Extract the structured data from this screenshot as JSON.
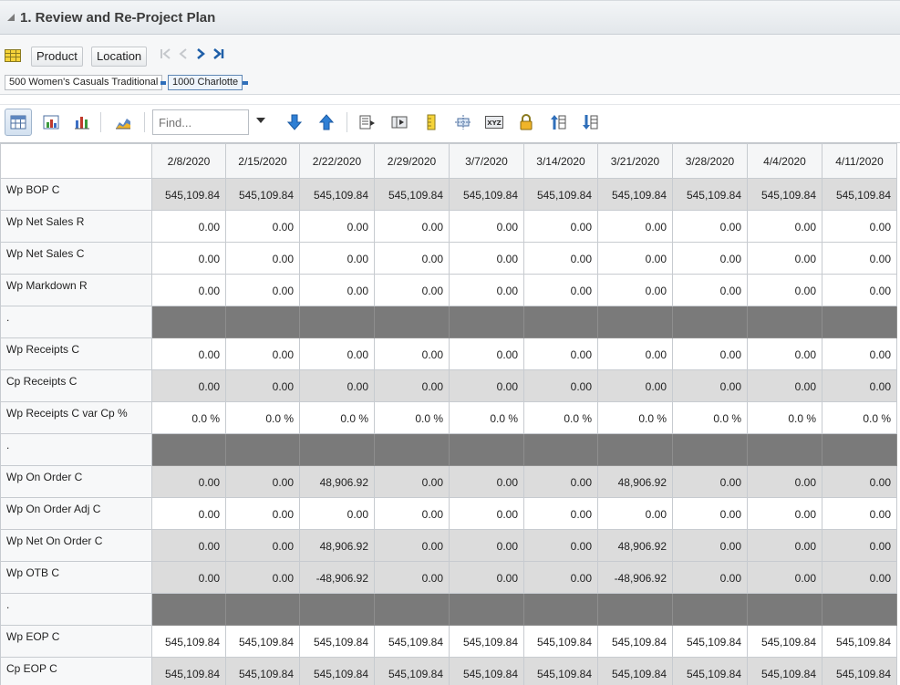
{
  "title": "1. Review and Re-Project Plan",
  "header": {
    "product_label": "Product",
    "location_label": "Location",
    "breadcrumbs": [
      "500 Women's Casuals Traditional",
      "1000 Charlotte"
    ]
  },
  "toolbar": {
    "find_placeholder": "Find..."
  },
  "grid": {
    "columns": [
      "2/8/2020",
      "2/15/2020",
      "2/22/2020",
      "2/29/2020",
      "3/7/2020",
      "3/14/2020",
      "3/21/2020",
      "3/28/2020",
      "4/4/2020",
      "4/11/2020"
    ],
    "rows": [
      {
        "label": "Wp BOP C",
        "style": "shade",
        "values": [
          "545,109.84",
          "545,109.84",
          "545,109.84",
          "545,109.84",
          "545,109.84",
          "545,109.84",
          "545,109.84",
          "545,109.84",
          "545,109.84",
          "545,109.84"
        ]
      },
      {
        "label": "Wp Net Sales R",
        "style": "white",
        "values": [
          "0.00",
          "0.00",
          "0.00",
          "0.00",
          "0.00",
          "0.00",
          "0.00",
          "0.00",
          "0.00",
          "0.00"
        ]
      },
      {
        "label": "Wp Net Sales C",
        "style": "white",
        "values": [
          "0.00",
          "0.00",
          "0.00",
          "0.00",
          "0.00",
          "0.00",
          "0.00",
          "0.00",
          "0.00",
          "0.00"
        ]
      },
      {
        "label": "Wp Markdown R",
        "style": "white",
        "values": [
          "0.00",
          "0.00",
          "0.00",
          "0.00",
          "0.00",
          "0.00",
          "0.00",
          "0.00",
          "0.00",
          "0.00"
        ]
      },
      {
        "label": ".",
        "style": "spacer",
        "values": [
          "",
          "",
          "",
          "",
          "",
          "",
          "",
          "",
          "",
          ""
        ]
      },
      {
        "label": "Wp Receipts C",
        "style": "white",
        "values": [
          "0.00",
          "0.00",
          "0.00",
          "0.00",
          "0.00",
          "0.00",
          "0.00",
          "0.00",
          "0.00",
          "0.00"
        ]
      },
      {
        "label": "Cp Receipts C",
        "style": "shade",
        "values": [
          "0.00",
          "0.00",
          "0.00",
          "0.00",
          "0.00",
          "0.00",
          "0.00",
          "0.00",
          "0.00",
          "0.00"
        ]
      },
      {
        "label": "Wp Receipts C var Cp %",
        "style": "white",
        "values": [
          "0.0 %",
          "0.0 %",
          "0.0 %",
          "0.0 %",
          "0.0 %",
          "0.0 %",
          "0.0 %",
          "0.0 %",
          "0.0 %",
          "0.0 %"
        ]
      },
      {
        "label": ".",
        "style": "spacer",
        "values": [
          "",
          "",
          "",
          "",
          "",
          "",
          "",
          "",
          "",
          ""
        ]
      },
      {
        "label": "Wp On Order C",
        "style": "shade",
        "values": [
          "0.00",
          "0.00",
          "48,906.92",
          "0.00",
          "0.00",
          "0.00",
          "48,906.92",
          "0.00",
          "0.00",
          "0.00"
        ]
      },
      {
        "label": "Wp On Order Adj C",
        "style": "white",
        "values": [
          "0.00",
          "0.00",
          "0.00",
          "0.00",
          "0.00",
          "0.00",
          "0.00",
          "0.00",
          "0.00",
          "0.00"
        ]
      },
      {
        "label": "Wp Net On Order C",
        "style": "shade",
        "values": [
          "0.00",
          "0.00",
          "48,906.92",
          "0.00",
          "0.00",
          "0.00",
          "48,906.92",
          "0.00",
          "0.00",
          "0.00"
        ]
      },
      {
        "label": "Wp OTB C",
        "style": "shade",
        "values": [
          "0.00",
          "0.00",
          "-48,906.92",
          "0.00",
          "0.00",
          "0.00",
          "-48,906.92",
          "0.00",
          "0.00",
          "0.00"
        ]
      },
      {
        "label": ".",
        "style": "spacer",
        "values": [
          "",
          "",
          "",
          "",
          "",
          "",
          "",
          "",
          "",
          ""
        ]
      },
      {
        "label": "Wp EOP C",
        "style": "white",
        "values": [
          "545,109.84",
          "545,109.84",
          "545,109.84",
          "545,109.84",
          "545,109.84",
          "545,109.84",
          "545,109.84",
          "545,109.84",
          "545,109.84",
          "545,109.84"
        ]
      },
      {
        "label": "Cp EOP C",
        "style": "shade",
        "values": [
          "545,109.84",
          "545,109.84",
          "545,109.84",
          "545,109.84",
          "545,109.84",
          "545,109.84",
          "545,109.84",
          "545,109.84",
          "545,109.84",
          "545,109.84"
        ]
      }
    ]
  }
}
